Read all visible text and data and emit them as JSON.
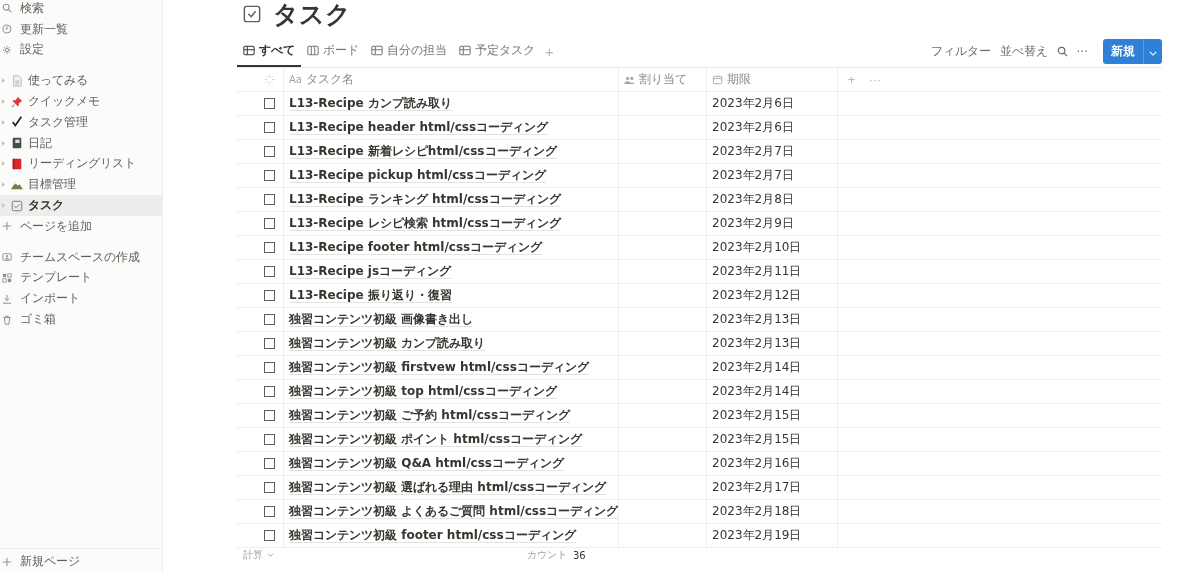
{
  "sidebar": {
    "tools": [
      {
        "kind": "search",
        "label": "検索"
      },
      {
        "kind": "clock",
        "label": "更新一覧"
      },
      {
        "kind": "gear",
        "label": "設定"
      }
    ],
    "pages": [
      {
        "kind": "doc",
        "label": "使ってみる",
        "selected": false
      },
      {
        "kind": "pin",
        "label": "クイックメモ",
        "selected": false
      },
      {
        "kind": "check",
        "label": "タスク管理",
        "selected": false
      },
      {
        "kind": "notebook",
        "label": "日記",
        "selected": false
      },
      {
        "kind": "book",
        "label": "リーディングリスト",
        "selected": false
      },
      {
        "kind": "mountain",
        "label": "目標管理",
        "selected": false
      },
      {
        "kind": "checkbox",
        "label": "タスク",
        "selected": true
      }
    ],
    "add_page": "ページを追加",
    "extras": [
      {
        "kind": "team",
        "label": "チームスペースの作成"
      },
      {
        "kind": "template",
        "label": "テンプレート"
      },
      {
        "kind": "import",
        "label": "インポート"
      },
      {
        "kind": "trash",
        "label": "ゴミ箱"
      }
    ],
    "new_page": "新規ページ"
  },
  "page": {
    "title": "タスク",
    "tabs": [
      {
        "kind": "table",
        "label": "すべて",
        "selected": true
      },
      {
        "kind": "board",
        "label": "ボード",
        "selected": false
      },
      {
        "kind": "table",
        "label": "自分の担当",
        "selected": false
      },
      {
        "kind": "table",
        "label": "予定タスク",
        "selected": false
      }
    ],
    "add_tab": "+",
    "toolbar": {
      "filter": "フィルター",
      "sort": "並べ替え",
      "more": "···",
      "new": "新規"
    },
    "table": {
      "columns": [
        {
          "kind": "title",
          "label": "タスク名",
          "prefix": "Aa"
        },
        {
          "kind": "person",
          "label": "割り当て"
        },
        {
          "kind": "date",
          "label": "期限"
        }
      ],
      "add_column": "+",
      "column_more": "···",
      "rows": [
        {
          "done": false,
          "name": "L13-Recipe カンプ読み取り",
          "due": "2023年2月6日"
        },
        {
          "done": false,
          "name": "L13-Recipe header html/cssコーディング",
          "due": "2023年2月6日"
        },
        {
          "done": false,
          "name": "L13-Recipe 新着レシピhtml/cssコーディング",
          "due": "2023年2月7日"
        },
        {
          "done": false,
          "name": "L13-Recipe pickup html/cssコーディング",
          "due": "2023年2月7日"
        },
        {
          "done": false,
          "name": "L13-Recipe ランキング html/cssコーディング",
          "due": "2023年2月8日"
        },
        {
          "done": false,
          "name": "L13-Recipe レシピ検索 html/cssコーディング",
          "due": "2023年2月9日"
        },
        {
          "done": false,
          "name": "L13-Recipe footer html/cssコーディング",
          "due": "2023年2月10日"
        },
        {
          "done": false,
          "name": "L13-Recipe jsコーディング",
          "due": "2023年2月11日"
        },
        {
          "done": false,
          "name": "L13-Recipe 振り返り・復習",
          "due": "2023年2月12日"
        },
        {
          "done": false,
          "name": "独習コンテンツ初級 画像書き出し",
          "due": "2023年2月13日"
        },
        {
          "done": false,
          "name": "独習コンテンツ初級 カンプ読み取り",
          "due": "2023年2月13日"
        },
        {
          "done": false,
          "name": "独習コンテンツ初級 firstvew html/cssコーディング",
          "due": "2023年2月14日"
        },
        {
          "done": false,
          "name": "独習コンテンツ初級 top html/cssコーディング",
          "due": "2023年2月14日"
        },
        {
          "done": false,
          "name": "独習コンテンツ初級 ご予約 html/cssコーディング",
          "due": "2023年2月15日"
        },
        {
          "done": false,
          "name": "独習コンテンツ初級 ポイント html/cssコーディング",
          "due": "2023年2月15日"
        },
        {
          "done": false,
          "name": "独習コンテンツ初級 Q&A html/cssコーディング",
          "due": "2023年2月16日"
        },
        {
          "done": false,
          "name": "独習コンテンツ初級 選ばれる理由 html/cssコーディング",
          "due": "2023年2月17日"
        },
        {
          "done": false,
          "name": "独習コンテンツ初級 よくあるご質問 html/cssコーディング",
          "due": "2023年2月18日"
        },
        {
          "done": false,
          "name": "独習コンテンツ初級 footer html/cssコーディング",
          "due": "2023年2月19日"
        }
      ],
      "footer": {
        "calc": "計算",
        "count_label": "カウント",
        "count": "36"
      }
    }
  }
}
